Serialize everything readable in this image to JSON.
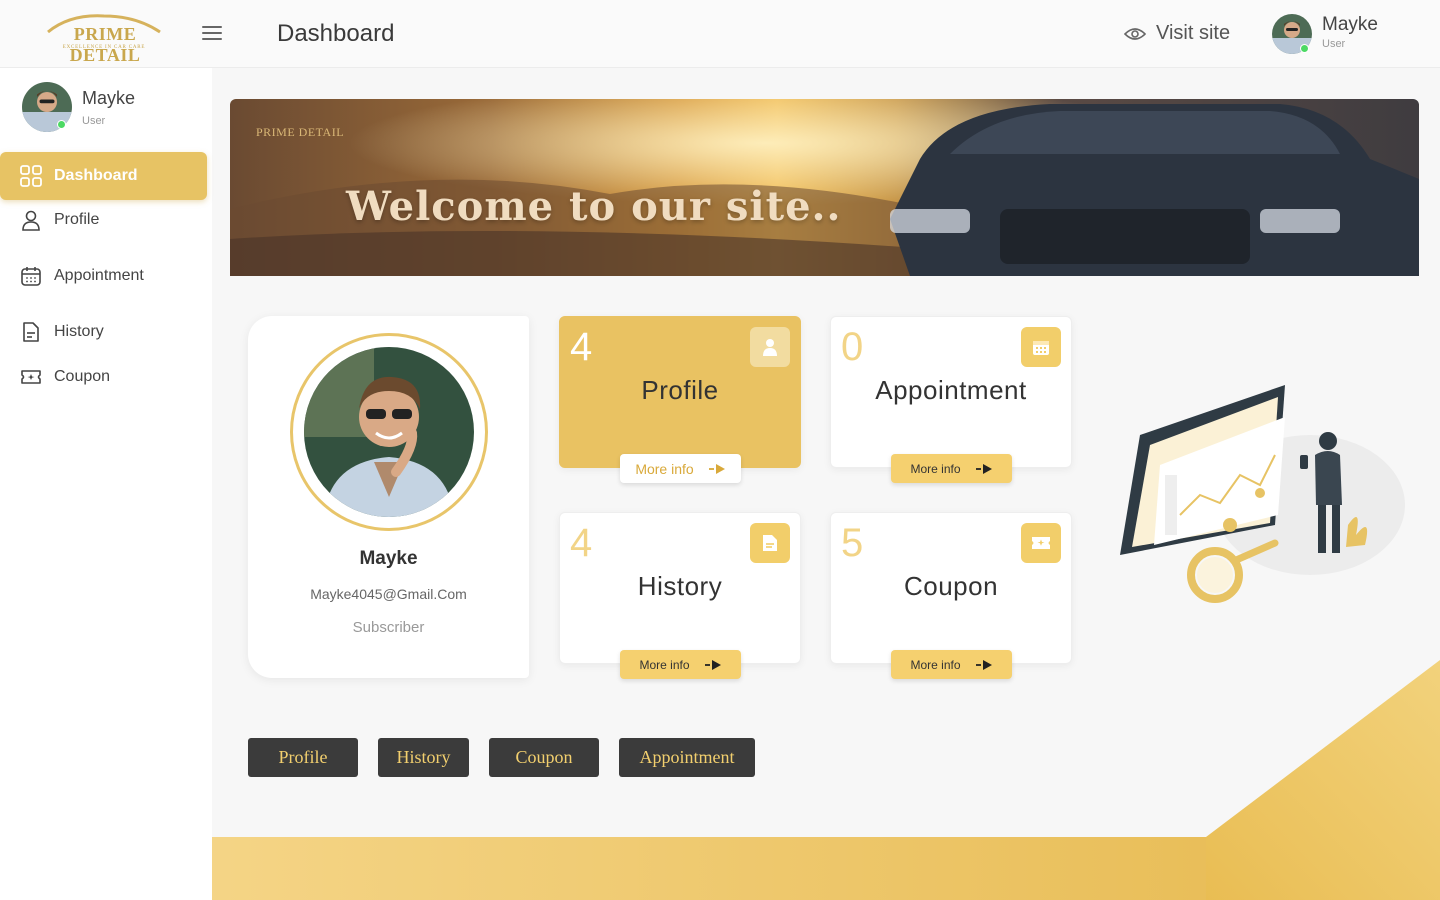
{
  "header": {
    "logo_text": "PRIME DETAIL",
    "logo_tagline": "EXCELLENCE IN CAR CARE",
    "title": "Dashboard",
    "visit_site": "Visit site",
    "user": {
      "name": "Mayke",
      "role": "User"
    }
  },
  "sidebar": {
    "user": {
      "name": "Mayke",
      "role": "User"
    },
    "items": [
      {
        "label": "Dashboard",
        "icon": "grid-icon",
        "active": true
      },
      {
        "label": "Profile",
        "icon": "user-icon"
      },
      {
        "label": "Appointment",
        "icon": "calendar-icon"
      },
      {
        "label": "History",
        "icon": "document-icon"
      },
      {
        "label": "Coupon",
        "icon": "ticket-icon"
      }
    ]
  },
  "banner": {
    "logo_text": "PRIME DETAIL",
    "welcome": "Welcome to our site.."
  },
  "profile_card": {
    "name": "Mayke",
    "email": "Mayke4045@Gmail.Com",
    "subscription": "Subscriber"
  },
  "stats": [
    {
      "count": "4",
      "label": "Profile",
      "more": "More info",
      "icon": "user-icon"
    },
    {
      "count": "0",
      "label": "Appointment",
      "more": "More info",
      "icon": "calendar-icon"
    },
    {
      "count": "4",
      "label": "History",
      "more": "More info",
      "icon": "document-icon"
    },
    {
      "count": "5",
      "label": "Coupon",
      "more": "More info",
      "icon": "ticket-icon"
    }
  ],
  "quick_links": [
    "Profile",
    "History",
    "Coupon",
    "Appointment"
  ],
  "colors": {
    "accent": "#e7c364",
    "dark_button": "#3b3b3b",
    "online": "#4cd964"
  }
}
